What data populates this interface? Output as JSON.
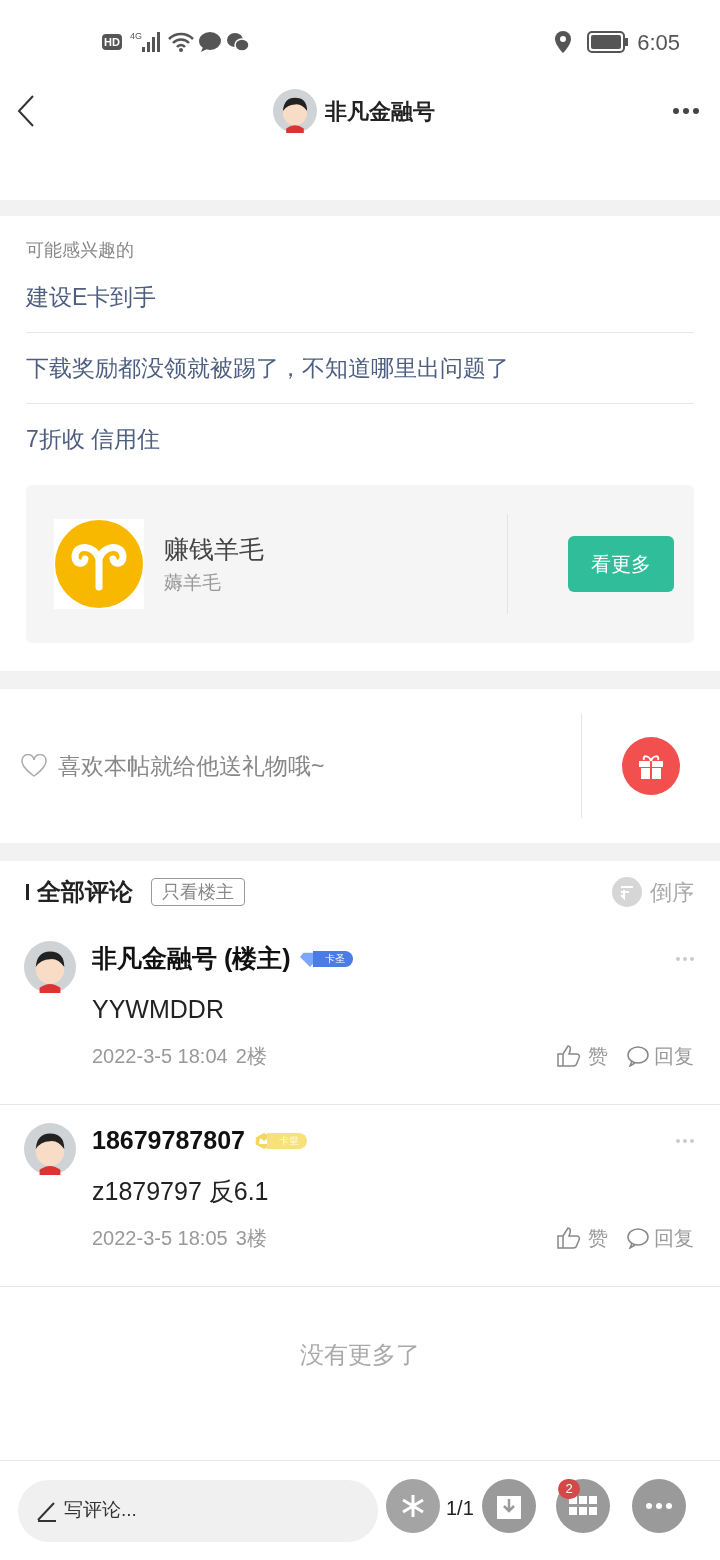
{
  "status_bar": {
    "hd": "HD",
    "network": "4G",
    "time": "6:05"
  },
  "header": {
    "title": "非凡金融号"
  },
  "recommendations": {
    "heading": "可能感兴趣的",
    "items": [
      "建设E卡到手",
      "下载奖励都没领就被踢了，不知道哪里出问题了",
      "7折收 信用住"
    ]
  },
  "group_card": {
    "name": "赚钱羊毛",
    "subtitle": "薅羊毛",
    "button": "看更多"
  },
  "gift": {
    "prompt": "喜欢本帖就给他送礼物哦~"
  },
  "comments_header": {
    "title": "全部评论",
    "filter": "只看楼主",
    "sort": "倒序"
  },
  "comments": [
    {
      "author": "非凡金融号 (楼主)",
      "badge": "卡圣",
      "kind": "diamond",
      "text": "YYWMDDR",
      "date": "2022-3-5 18:04",
      "floor": "2楼",
      "like": "赞",
      "reply": "回复"
    },
    {
      "author": "18679787807",
      "badge": "卡皇",
      "kind": "crown",
      "text": "z1879797  反6.1",
      "date": "2022-3-5 18:05",
      "floor": "3楼",
      "like": "赞",
      "reply": "回复"
    }
  ],
  "end_note": "没有更多了",
  "bottom_bar": {
    "placeholder": "写评论...",
    "page": "1/1",
    "badge_count": "2"
  }
}
